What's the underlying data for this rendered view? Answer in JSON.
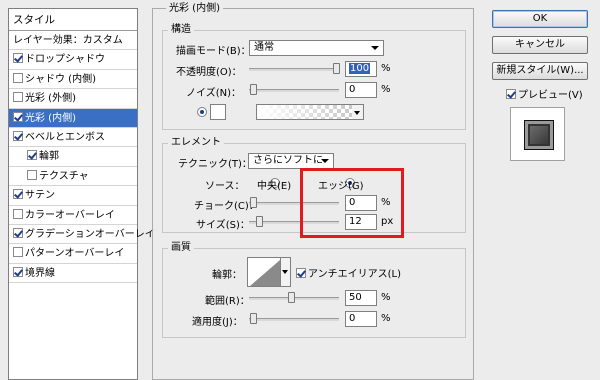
{
  "sidebar": {
    "header": "スタイル",
    "items": [
      {
        "label": "レイヤー効果：カスタム",
        "checkbox": false,
        "checked": false,
        "selected": false,
        "indent": false
      },
      {
        "label": "ドロップシャドウ",
        "checkbox": true,
        "checked": true,
        "selected": false,
        "indent": false
      },
      {
        "label": "シャドウ (内側)",
        "checkbox": true,
        "checked": false,
        "selected": false,
        "indent": false
      },
      {
        "label": "光彩 (外側)",
        "checkbox": true,
        "checked": false,
        "selected": false,
        "indent": false
      },
      {
        "label": "光彩 (内側)",
        "checkbox": true,
        "checked": true,
        "selected": true,
        "indent": false
      },
      {
        "label": "ベベルとエンボス",
        "checkbox": true,
        "checked": true,
        "selected": false,
        "indent": false
      },
      {
        "label": "輪郭",
        "checkbox": true,
        "checked": true,
        "selected": false,
        "indent": true
      },
      {
        "label": "テクスチャ",
        "checkbox": true,
        "checked": false,
        "selected": false,
        "indent": true
      },
      {
        "label": "サテン",
        "checkbox": true,
        "checked": true,
        "selected": false,
        "indent": false
      },
      {
        "label": "カラーオーバーレイ",
        "checkbox": true,
        "checked": false,
        "selected": false,
        "indent": false
      },
      {
        "label": "グラデーションオーバーレイ",
        "checkbox": true,
        "checked": true,
        "selected": false,
        "indent": false
      },
      {
        "label": "パターンオーバーレイ",
        "checkbox": true,
        "checked": false,
        "selected": false,
        "indent": false
      },
      {
        "label": "境界線",
        "checkbox": true,
        "checked": true,
        "selected": false,
        "indent": false
      }
    ]
  },
  "panel": {
    "title": "光彩 (内側)",
    "structure": {
      "title": "構造",
      "blend_mode_label": "描画モード(B)：",
      "blend_mode_value": "通常",
      "opacity_label": "不透明度(O)：",
      "opacity_value": "100",
      "opacity_unit": "%",
      "noise_label": "ノイズ(N)：",
      "noise_value": "0",
      "noise_unit": "%"
    },
    "elements": {
      "title": "エレメント",
      "technique_label": "テクニック(T)：",
      "technique_value": "さらにソフトに",
      "source_label": "ソース：",
      "center_label": "中央(E)",
      "edge_label": "エッジ(G)",
      "choke_label": "チョーク(C)：",
      "choke_value": "0",
      "choke_unit": "%",
      "size_label": "サイズ(S)：",
      "size_value": "12",
      "size_unit": "px"
    },
    "quality": {
      "title": "画質",
      "contour_label": "輪郭：",
      "antialias_label": "アンチエイリアス(L)",
      "range_label": "範囲(R)：",
      "range_value": "50",
      "range_unit": "%",
      "jitter_label": "適用度(J)：",
      "jitter_value": "0",
      "jitter_unit": "%"
    }
  },
  "actions": {
    "ok": "OK",
    "cancel": "キャンセル",
    "new_style": "新規スタイル(W)...",
    "preview": "プレビュー(V)"
  },
  "colors": {
    "selection": "#3a6fc5",
    "highlight_box": "#e01b1b"
  }
}
